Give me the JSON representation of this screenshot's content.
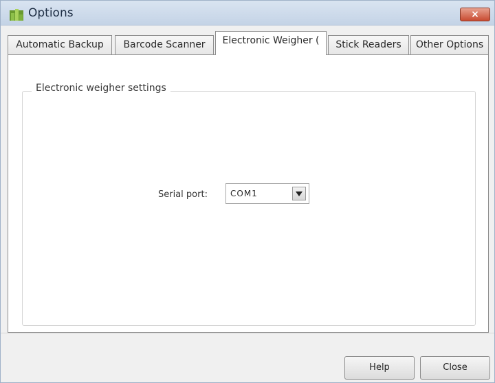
{
  "window": {
    "title": "Options",
    "close_symbol": "×"
  },
  "tabs": [
    {
      "label": "Automatic Backup",
      "active": false
    },
    {
      "label": "Barcode Scanner",
      "active": false
    },
    {
      "label": "Electronic Weigher (",
      "active": true
    },
    {
      "label": "Stick Readers",
      "active": false
    },
    {
      "label": "Other Options",
      "active": false
    }
  ],
  "group": {
    "title": "Electronic weigher settings",
    "serial_label": "Serial port:",
    "serial_value": "COM1"
  },
  "buttons": {
    "help": "Help",
    "close": "Close"
  },
  "colors": {
    "titlebar": "#c4d3e6",
    "close_button": "#c94b31",
    "window_bg": "#f0f0f0",
    "content_bg": "#ffffff"
  }
}
